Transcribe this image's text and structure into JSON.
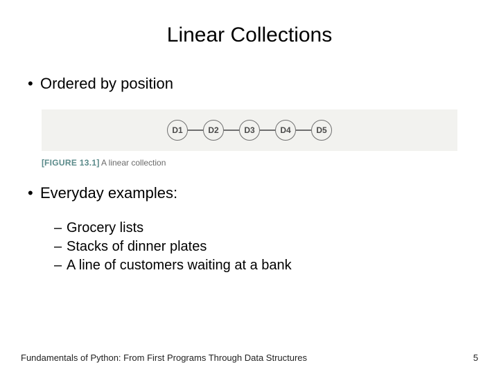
{
  "title": "Linear Collections",
  "bullets": {
    "ordered": "Ordered by position",
    "examples": "Everyday examples:",
    "sub": {
      "grocery": "Grocery lists",
      "plates": "Stacks of dinner plates",
      "bank": "A line of customers waiting at a bank"
    }
  },
  "figure": {
    "nodes": {
      "n1": "D1",
      "n2": "D2",
      "n3": "D3",
      "n4": "D4",
      "n5": "D5"
    },
    "label": "FIGURE 13.1",
    "caption": "A linear collection"
  },
  "footer": {
    "text": "Fundamentals of Python: From First Programs Through Data Structures",
    "page": "5"
  }
}
